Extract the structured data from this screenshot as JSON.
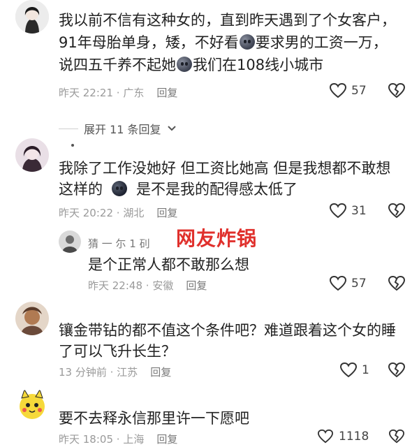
{
  "watermark": "网友炸锅",
  "comments": [
    {
      "lines": [
        "我以前不信有这种女的，直到昨天遇到了个女客户，",
        "91年母胎单身，矮，不好看",
        "要求男的工资一万，",
        "说四五千养不起她",
        "我们在108线小城市"
      ],
      "time": "昨天 22:21",
      "location": "广东",
      "reply": "回复",
      "likes": "57"
    },
    {
      "expand": "展开 11 条回复",
      "nick": "",
      "lines": [
        "我除了工作没她好 但工资比她高 但是我想都不敢想",
        "这样的",
        "是不是我的配得感太低了"
      ],
      "time": "昨天 20:22",
      "location": "湖北",
      "reply": "回复",
      "likes": "31"
    },
    {
      "nick": "猜 一 尓 1 矵",
      "lines": [
        "是个正常人都不敢那么想"
      ],
      "time": "昨天 22:48",
      "location": "安徽",
      "reply": "回复",
      "likes": "57"
    },
    {
      "lines": [
        "镶金带钻的都不值这个条件吧？难道跟着这个女的睡",
        "了可以飞升长生？"
      ],
      "time": "13 分钟前",
      "location": "江苏",
      "reply": "回复",
      "likes": "1"
    },
    {
      "lines": [
        "要不去释永信那里许一下愿吧"
      ],
      "time": "昨天 18:05",
      "location": "上海",
      "reply": "回复",
      "likes": "1118"
    }
  ],
  "icons": {
    "like": "heart-outline-icon",
    "dislike": "broken-heart-icon",
    "expand": "chevron-down-icon",
    "emoji": "emoji-icon"
  }
}
